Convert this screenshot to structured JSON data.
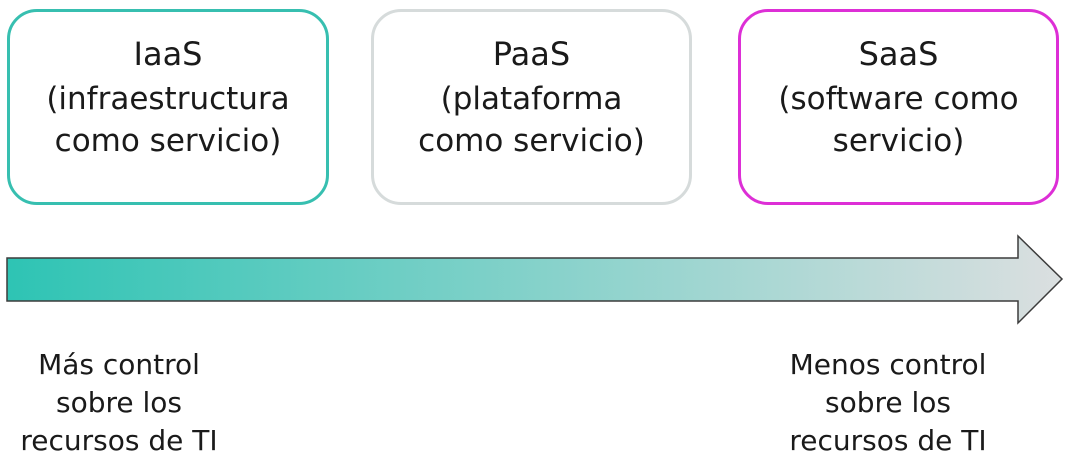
{
  "models": [
    {
      "title": "IaaS",
      "description": "(infraestructura como servicio)",
      "border_color": "#37bfb0"
    },
    {
      "title": "PaaS",
      "description": "(plataforma como servicio)",
      "border_color": "#d6dbdb"
    },
    {
      "title": "SaaS",
      "description": "(software como servicio)",
      "border_color": "#dd2fd6"
    }
  ],
  "arrow": {
    "gradient_start": "#2ec4b4",
    "gradient_end": "#dbdfe0",
    "outline_color": "#3c3c3c"
  },
  "captions": {
    "left": "Más control sobre los recursos de TI",
    "right": "Menos control sobre los recursos de TI"
  }
}
